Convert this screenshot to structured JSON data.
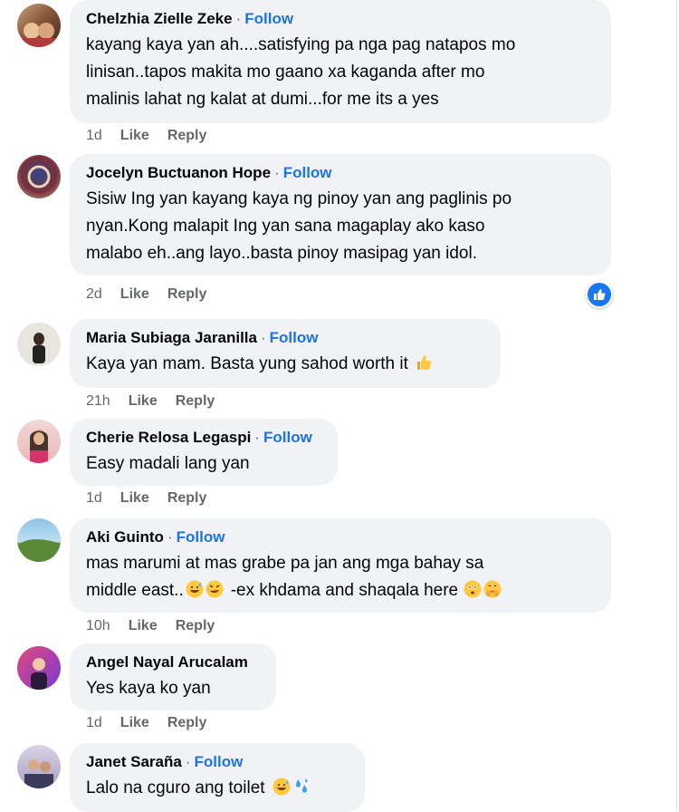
{
  "comments": [
    {
      "name": "Chelzhia Zielle Zeke",
      "follow": "Follow",
      "lines": [
        "kayang kaya yan ah....satisfying pa nga pag natapos mo",
        "linisan..tapos makita mo gaano xa kaganda after mo",
        "malinis lahat ng kalat at dumi...for me its a yes"
      ],
      "time": "1d",
      "like": "Like",
      "reply": "Reply"
    },
    {
      "name": "Jocelyn Buctuanon Hope",
      "follow": "Follow",
      "lines": [
        "Sisiw Ing yan kayang kaya ng pinoy yan ang paglinis po",
        "nyan.Kong malapit Ing yan sana magaplay ako kaso",
        "malabo eh..ang layo..basta pinoy masipag yan idol."
      ],
      "time": "2d",
      "like": "Like",
      "reply": "Reply",
      "reaction_icon": "like-reaction-icon"
    },
    {
      "name": "Maria Subiaga Jaranilla",
      "follow": "Follow",
      "lines": [
        "Kaya yan mam. Basta yung sahod worth it"
      ],
      "emoji": [
        "thumbs-up-emoji"
      ],
      "time": "21h",
      "like": "Like",
      "reply": "Reply"
    },
    {
      "name": "Cherie Relosa Legaspi",
      "follow": "Follow",
      "lines": [
        "Easy madali lang yan"
      ],
      "time": "1d",
      "like": "Like",
      "reply": "Reply"
    },
    {
      "name": "Aki Guinto",
      "follow": "Follow",
      "lines": [
        "mas marumi at mas grabe pa jan ang mga bahay sa",
        "middle east.."
      ],
      "line2_suffix": "-ex khdama and shaqala here",
      "emoji": [
        "grinning-sweat-emoji",
        "rofl-emoji",
        "flushed-emoji",
        "smiling-hands-emoji"
      ],
      "time": "10h",
      "like": "Like",
      "reply": "Reply"
    },
    {
      "name": "Angel Nayal Arucalam",
      "follow": "",
      "lines": [
        "Yes kaya ko yan"
      ],
      "time": "1d",
      "like": "Like",
      "reply": "Reply"
    },
    {
      "name": "Janet Saraña",
      "follow": "Follow",
      "lines": [
        "Lalo na cguro ang toilet"
      ],
      "emoji": [
        "grinning-sweat-emoji",
        "sweat-droplets-emoji"
      ],
      "time": "",
      "like": "",
      "reply": ""
    }
  ],
  "separator": "·",
  "colors": {
    "bubble": "#f0f2f5",
    "follow": "#1b74e4",
    "meta": "#65676b",
    "like_badge": "#1877f2"
  }
}
